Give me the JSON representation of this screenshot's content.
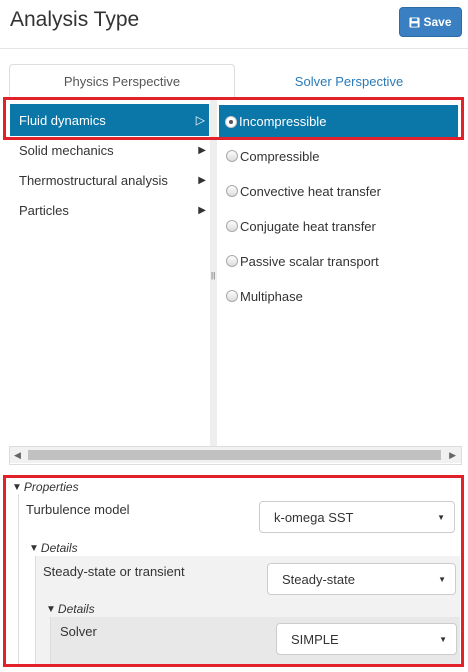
{
  "header": {
    "title": "Analysis Type",
    "save_label": "Save"
  },
  "tabs": [
    {
      "label": "Physics Perspective",
      "active": true
    },
    {
      "label": "Solver Perspective",
      "active": false
    }
  ],
  "categories": [
    {
      "label": "Fluid dynamics",
      "arrow": "▷",
      "selected": true
    },
    {
      "label": "Solid mechanics",
      "arrow": "▶",
      "selected": false
    },
    {
      "label": "Thermostructural analysis",
      "arrow": "▶",
      "selected": false
    },
    {
      "label": "Particles",
      "arrow": "▶",
      "selected": false
    }
  ],
  "options": [
    {
      "label": "Incompressible",
      "selected": true
    },
    {
      "label": "Compressible",
      "selected": false
    },
    {
      "label": "Convective heat transfer",
      "selected": false
    },
    {
      "label": "Conjugate heat transfer",
      "selected": false
    },
    {
      "label": "Passive scalar transport",
      "selected": false
    },
    {
      "label": "Multiphase",
      "selected": false
    }
  ],
  "splitter_grip": "||",
  "scrollbar": {
    "left_arrow": "◀",
    "right_arrow": "▶"
  },
  "properties": {
    "title": "Properties",
    "turbulence_model": {
      "label": "Turbulence model",
      "value": "k-omega SST"
    },
    "details1": {
      "title": "Details",
      "time": {
        "label": "Steady-state or transient",
        "value": "Steady-state"
      },
      "details2": {
        "title": "Details",
        "solver": {
          "label": "Solver",
          "value": "SIMPLE"
        }
      }
    }
  },
  "glyphs": {
    "expanded": "▼",
    "caret": "▼"
  },
  "colors": {
    "accent": "#0b76a8",
    "save_button": "#3a7fc1",
    "highlight_border": "#e3212b"
  }
}
